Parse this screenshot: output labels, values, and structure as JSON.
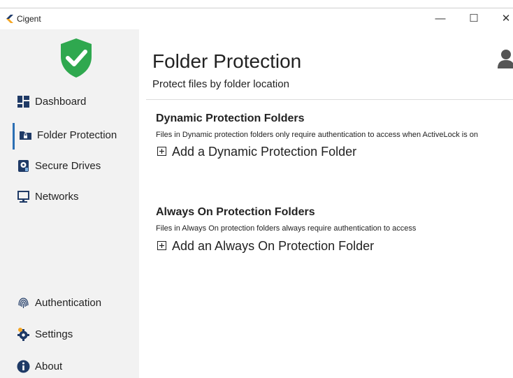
{
  "window": {
    "title": "Cigent",
    "minimize_glyph": "—",
    "maximize_glyph": "☐",
    "close_glyph": "✕"
  },
  "colors": {
    "sidebar_bg": "#f2f2f2",
    "shield_green": "#2fa84f",
    "nav_icon": "#1f3a66",
    "active_accent": "#2b6fb4"
  },
  "sidebar": {
    "logo_icon": "shield-check-icon",
    "items": [
      {
        "label": "Dashboard",
        "icon": "dashboard-icon",
        "active": false
      },
      {
        "label": "Folder Protection",
        "icon": "folder-lock-icon",
        "active": true
      },
      {
        "label": "Secure Drives",
        "icon": "secure-drive-icon",
        "active": false
      },
      {
        "label": "Networks",
        "icon": "monitor-icon",
        "active": false
      },
      {
        "label": "Authentication",
        "icon": "fingerprint-icon",
        "active": false
      },
      {
        "label": "Settings",
        "icon": "gear-icon",
        "active": false
      },
      {
        "label": "About",
        "icon": "info-icon",
        "active": false
      }
    ]
  },
  "main": {
    "title": "Folder Protection",
    "subtitle": "Protect files by folder location",
    "user_icon": "user-icon",
    "sections": [
      {
        "title": "Dynamic Protection Folders",
        "description": "Files in Dynamic protection folders only require authentication to access when ActiveLock is on",
        "add_label": "Add a Dynamic Protection Folder"
      },
      {
        "title": "Always On Protection Folders",
        "description": "Files in Always On protection folders always require authentication to access",
        "add_label": "Add an Always On Protection Folder"
      }
    ]
  }
}
